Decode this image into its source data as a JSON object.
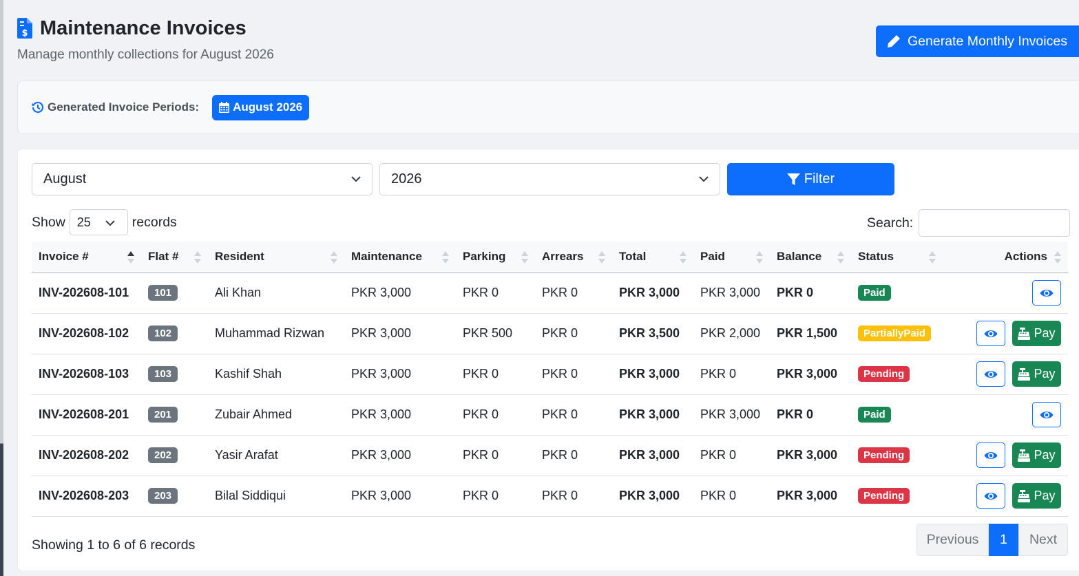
{
  "header": {
    "title": "Maintenance Invoices",
    "subtitle": "Manage monthly collections for August 2026",
    "generate_label": "Generate Monthly Invoices"
  },
  "periods": {
    "label": "Generated Invoice Periods:",
    "items": [
      "August 2026"
    ]
  },
  "filters": {
    "month": "August",
    "year": "2026",
    "filter_label": "Filter"
  },
  "table_controls": {
    "show_label": "Show",
    "page_length": "25",
    "records_label": "records",
    "search_label": "Search:",
    "search_value": ""
  },
  "table": {
    "columns": [
      "Invoice #",
      "Flat #",
      "Resident",
      "Maintenance",
      "Parking",
      "Arrears",
      "Total",
      "Paid",
      "Balance",
      "Status",
      "Actions"
    ],
    "pay_label": "Pay",
    "rows": [
      {
        "invoice": "INV-202608-101",
        "flat": "101",
        "resident": "Ali Khan",
        "maintenance": "PKR 3,000",
        "parking": "PKR 0",
        "arrears": "PKR 0",
        "total": "PKR 3,000",
        "paid": "PKR 3,000",
        "balance": "PKR 0",
        "status": "Paid",
        "can_pay": false
      },
      {
        "invoice": "INV-202608-102",
        "flat": "102",
        "resident": "Muhammad Rizwan",
        "maintenance": "PKR 3,000",
        "parking": "PKR 500",
        "arrears": "PKR 0",
        "total": "PKR 3,500",
        "paid": "PKR 2,000",
        "balance": "PKR 1,500",
        "status": "PartiallyPaid",
        "can_pay": true
      },
      {
        "invoice": "INV-202608-103",
        "flat": "103",
        "resident": "Kashif Shah",
        "maintenance": "PKR 3,000",
        "parking": "PKR 0",
        "arrears": "PKR 0",
        "total": "PKR 3,000",
        "paid": "PKR 0",
        "balance": "PKR 3,000",
        "status": "Pending",
        "can_pay": true
      },
      {
        "invoice": "INV-202608-201",
        "flat": "201",
        "resident": "Zubair Ahmed",
        "maintenance": "PKR 3,000",
        "parking": "PKR 0",
        "arrears": "PKR 0",
        "total": "PKR 3,000",
        "paid": "PKR 3,000",
        "balance": "PKR 0",
        "status": "Paid",
        "can_pay": false
      },
      {
        "invoice": "INV-202608-202",
        "flat": "202",
        "resident": "Yasir Arafat",
        "maintenance": "PKR 3,000",
        "parking": "PKR 0",
        "arrears": "PKR 0",
        "total": "PKR 3,000",
        "paid": "PKR 0",
        "balance": "PKR 3,000",
        "status": "Pending",
        "can_pay": true
      },
      {
        "invoice": "INV-202608-203",
        "flat": "203",
        "resident": "Bilal Siddiqui",
        "maintenance": "PKR 3,000",
        "parking": "PKR 0",
        "arrears": "PKR 0",
        "total": "PKR 3,000",
        "paid": "PKR 0",
        "balance": "PKR 3,000",
        "status": "Pending",
        "can_pay": true
      }
    ]
  },
  "footer": {
    "showing": "Showing 1 to 6 of 6 records",
    "previous": "Previous",
    "current_page": "1",
    "next": "Next"
  },
  "colors": {
    "primary": "#0d6efd",
    "success": "#198754",
    "danger": "#dc3545",
    "warning": "#ffc107",
    "secondary": "#6c757d"
  },
  "icons": {
    "title": "invoice-dollar-icon",
    "generate": "pencil-icon",
    "periods": "history-icon",
    "period_badge": "calendar-icon",
    "filter": "funnel-icon",
    "view": "eye-icon",
    "pay": "cash-register-icon"
  }
}
